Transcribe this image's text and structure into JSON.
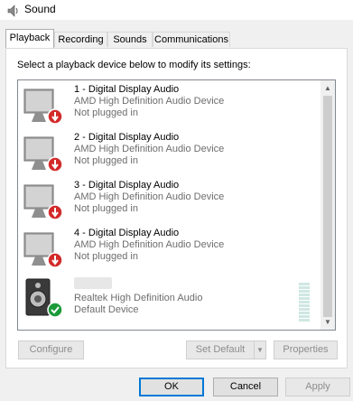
{
  "window": {
    "title": "Sound"
  },
  "tabs": [
    {
      "label": "Playback",
      "active": true
    },
    {
      "label": "Recording",
      "active": false
    },
    {
      "label": "Sounds",
      "active": false
    },
    {
      "label": "Communications",
      "active": false
    }
  ],
  "playback": {
    "instruction": "Select a playback device below to modify its settings:",
    "devices": [
      {
        "name": "1 - Digital Display Audio",
        "driver": "AMD High Definition Audio Device",
        "status": "Not plugged in",
        "icon": "monitor-icon",
        "badge": "disconnected-arrow-icon"
      },
      {
        "name": "2 - Digital Display Audio",
        "driver": "AMD High Definition Audio Device",
        "status": "Not plugged in",
        "icon": "monitor-icon",
        "badge": "disconnected-arrow-icon"
      },
      {
        "name": "3 - Digital Display Audio",
        "driver": "AMD High Definition Audio Device",
        "status": "Not plugged in",
        "icon": "monitor-icon",
        "badge": "disconnected-arrow-icon"
      },
      {
        "name": "4 - Digital Display Audio",
        "driver": "AMD High Definition Audio Device",
        "status": "Not plugged in",
        "icon": "monitor-icon",
        "badge": "disconnected-arrow-icon"
      },
      {
        "name": "",
        "driver": "Realtek High Definition Audio",
        "status": "Default Device",
        "icon": "speaker-icon",
        "badge": "default-check-icon"
      }
    ]
  },
  "buttons": {
    "configure": "Configure",
    "set_default": "Set Default",
    "properties": "Properties",
    "ok": "OK",
    "cancel": "Cancel",
    "apply": "Apply"
  },
  "colors": {
    "accent": "#0078d7",
    "disconnected": "#d32a2a",
    "default_ok": "#1a9a3a"
  }
}
